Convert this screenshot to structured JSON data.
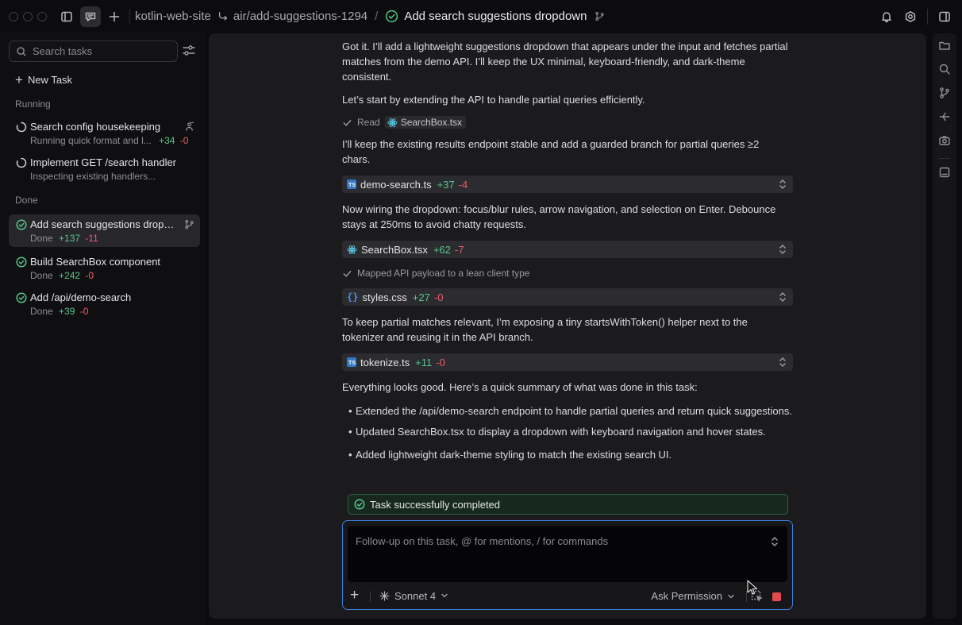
{
  "titlebar": {
    "project": "kotlin-web-site",
    "branch": "air/add-suggestions-1294",
    "separator": "/",
    "task_title": "Add search suggestions dropdown"
  },
  "sidebar": {
    "search_placeholder": "Search tasks",
    "new_task_label": "New Task",
    "running_label": "Running",
    "done_label": "Done",
    "running_tasks": [
      {
        "title": "Search config housekeeping",
        "subtitle": "Running quick format and l...",
        "added": "+34",
        "removed": "-0",
        "right_icon": "terminal-user-icon"
      },
      {
        "title": "Implement GET /search handler",
        "subtitle": "Inspecting existing handlers...",
        "added": "",
        "removed": ""
      }
    ],
    "done_tasks": [
      {
        "title": "Add search suggestions dropdown",
        "status": "Done",
        "added": "+137",
        "removed": "-11",
        "selected": true,
        "right_icon": "branch-icon"
      },
      {
        "title": "Build SearchBox component",
        "status": "Done",
        "added": "+242",
        "removed": "-0"
      },
      {
        "title": "Add /api/demo-search",
        "status": "Done",
        "added": "+39",
        "removed": "-0"
      }
    ]
  },
  "conversation": {
    "intro": "Got it. I’ll add a lightweight suggestions dropdown that appears under the input and fetches partial matches from the demo API. I’ll keep the UX minimal, keyboard-friendly, and dark-theme consistent.",
    "p_extend": "Let’s start by extending the API to handle partial queries efficiently.",
    "read_label": "Read",
    "read_file": "SearchBox.tsx",
    "p_guarded": "I’ll keep the existing results endpoint stable and add a guarded branch for partial queries ≥2 chars.",
    "file_demo": {
      "name": "demo-search.ts",
      "added": "+37",
      "removed": "-4"
    },
    "p_wiring": "Now wiring the dropdown: focus/blur rules, arrow navigation, and selection on Enter. Debounce stays at 250ms to avoid chatty requests.",
    "file_searchbox": {
      "name": "SearchBox.tsx",
      "added": "+62",
      "removed": "-7"
    },
    "mapped_label": "Mapped API payload to a lean client type",
    "file_styles": {
      "name": "styles.css",
      "added": "+27",
      "removed": "-0"
    },
    "p_tokenizer": "To keep partial matches relevant, I’m exposing a tiny startsWithToken() helper next to the tokenizer and reusing it in the API branch.",
    "file_tokenize": {
      "name": "tokenize.ts",
      "added": "+11",
      "removed": "-0"
    },
    "p_summary": "Everything looks good. Here’s a quick summary of what was done in this task:",
    "bullets": [
      "Extended the /api/demo-search endpoint to handle partial queries and return quick suggestions.",
      "Updated SearchBox.tsx to display a dropdown with keyboard navigation and hover states.",
      "Added lightweight dark-theme styling to match the existing search UI."
    ],
    "completed_label": "Task successfully completed"
  },
  "composer": {
    "placeholder": "Follow-up on this task, @ for mentions, / for commands",
    "model": "Sonnet 4",
    "permission": "Ask Permission"
  },
  "colors": {
    "accent_blue": "#3d7fd9",
    "added_green": "#57c78a",
    "removed_red": "#ec5f6a",
    "stop_red": "#e5484d",
    "ts_blue": "#3178c6"
  }
}
